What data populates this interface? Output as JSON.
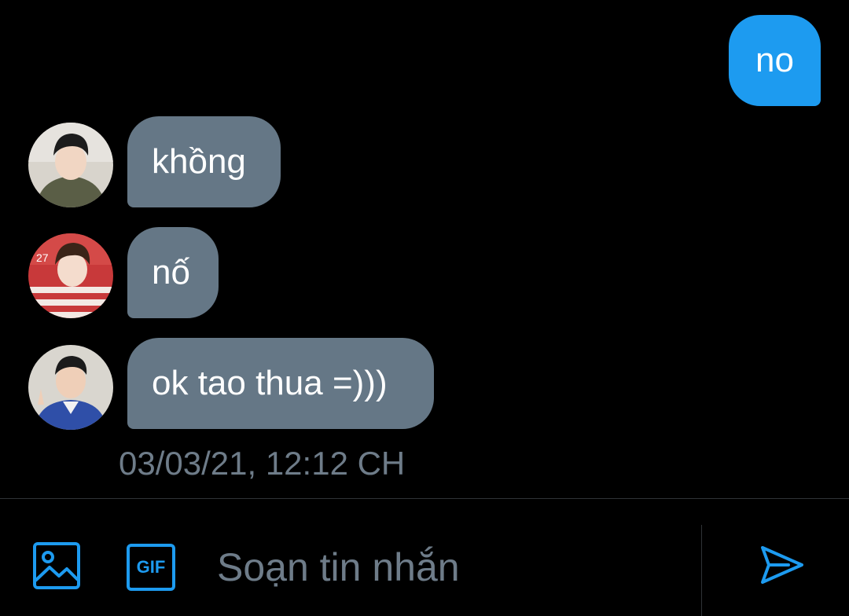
{
  "messages": [
    {
      "direction": "outgoing",
      "text": "no"
    },
    {
      "direction": "incoming",
      "text": "khồng",
      "avatar": "avatar-user-green-hoodie"
    },
    {
      "direction": "incoming",
      "text": "nố",
      "avatar": "avatar-user-red-stripes"
    },
    {
      "direction": "incoming",
      "text": "ok tao thua =)))",
      "avatar": "avatar-user-blue-jacket"
    }
  ],
  "timestamp": "03/03/21, 12:12 CH",
  "composer": {
    "placeholder": "Soạn tin nhắn",
    "value": "",
    "gif_label": "GIF",
    "icons": [
      "image-icon",
      "gif-icon",
      "send-icon"
    ]
  },
  "colors": {
    "background": "#000000",
    "outgoing_bubble": "#1d9bf0",
    "incoming_bubble": "#657786",
    "accent": "#1d9bf0",
    "muted_text": "#6e7c89"
  }
}
